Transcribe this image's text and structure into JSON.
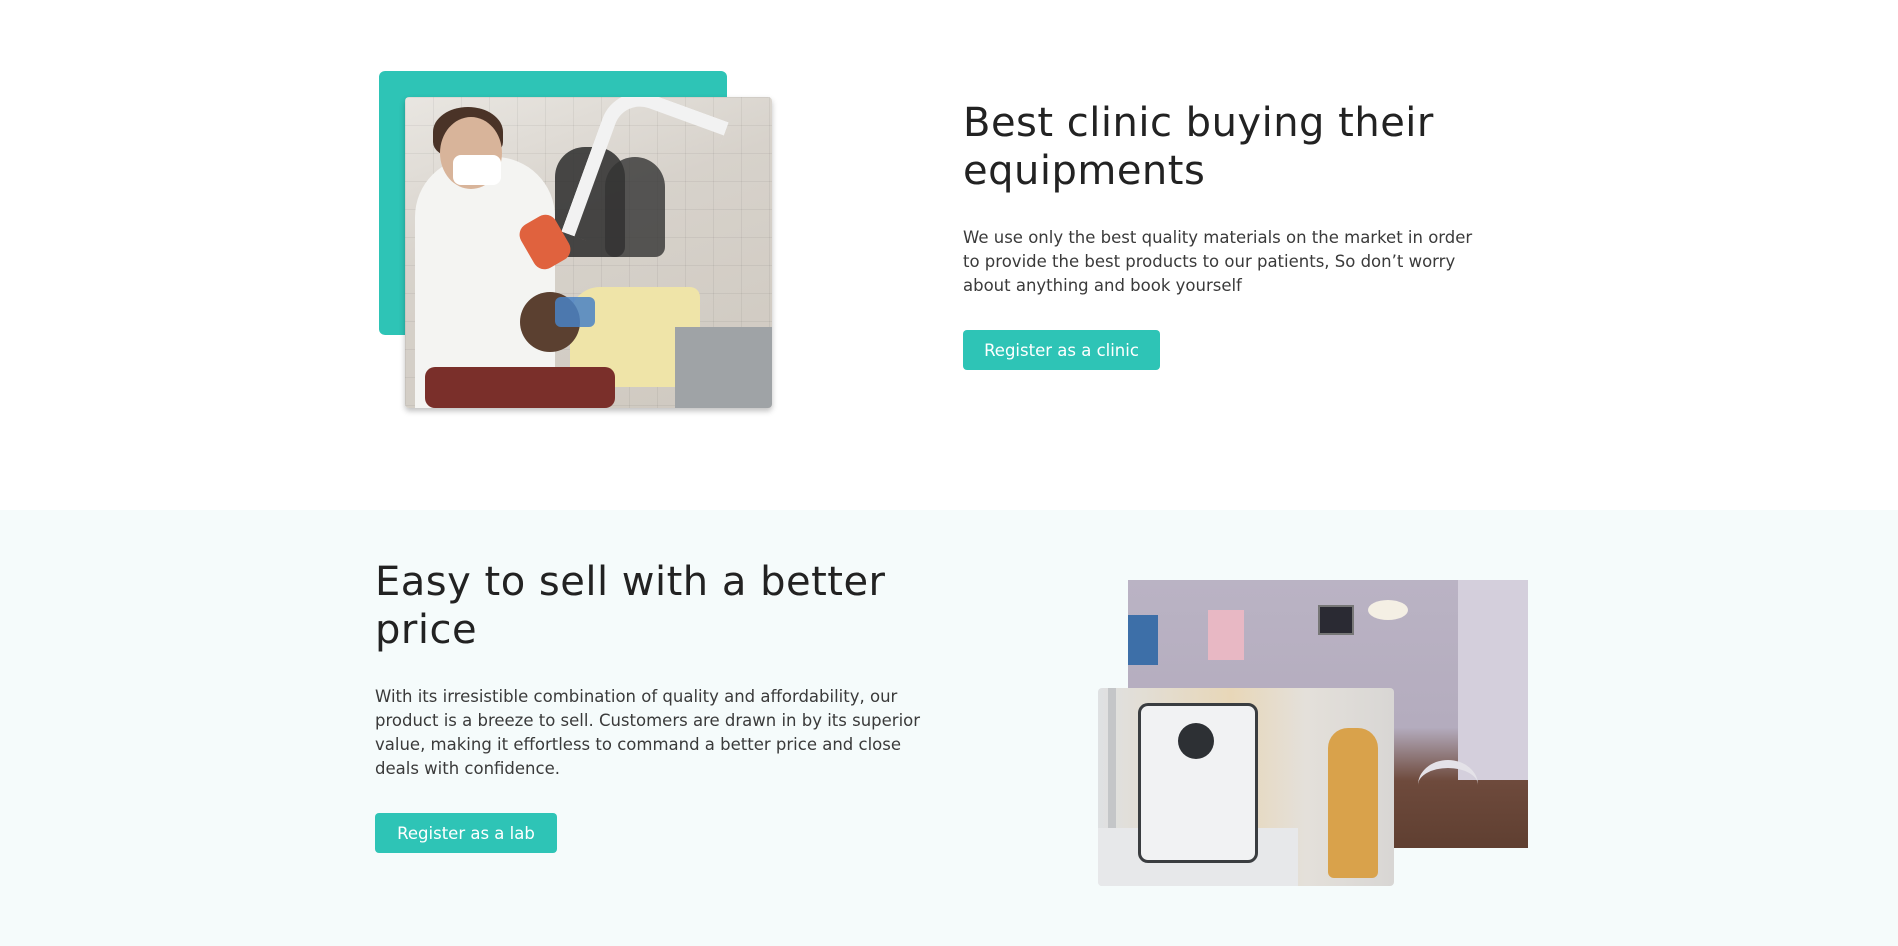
{
  "clinic_section": {
    "title": "Best clinic buying their equipments",
    "description": "We use only the best quality materials on the market in order to provide the best products to our patients, So don’t worry about anything and book yourself",
    "button_label": "Register as a clinic",
    "accent_color": "#2ec4b6"
  },
  "lab_section": {
    "title": "Easy to sell with a better price",
    "description": "With its irresistible combination of quality and affordability, our product is a breeze to sell. Customers are drawn in by its superior value, making it effortless to command a better price and close deals with confidence.",
    "button_label": "Register as a lab",
    "background_color": "#f5fbfb"
  }
}
